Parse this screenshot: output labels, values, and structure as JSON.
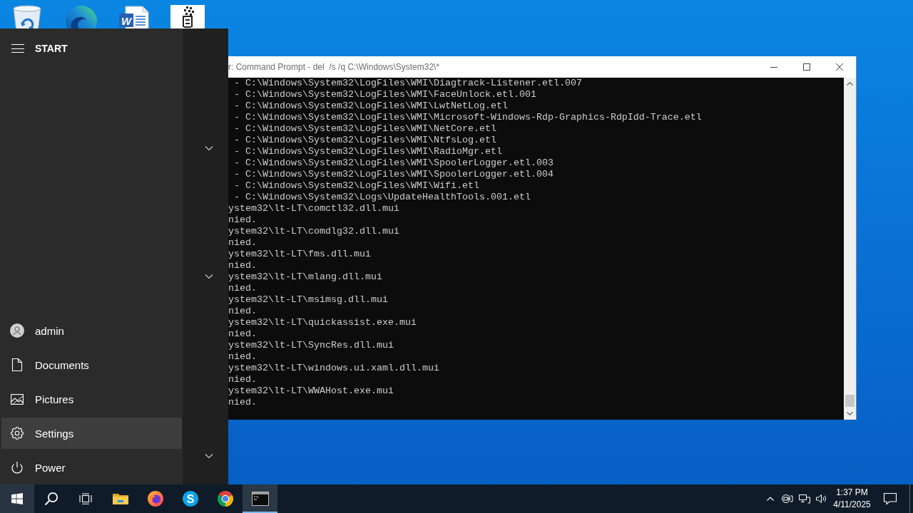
{
  "desktop_icons": [
    {
      "kind": "bin"
    },
    {
      "kind": "swirl"
    },
    {
      "kind": "document",
      "letter": "W"
    },
    {
      "kind": "pixel-art"
    }
  ],
  "console": {
    "title": "r: Command Prompt - del  /s /q C:\\Windows\\System32\\*",
    "lines": [
      " - C:\\Windows\\System32\\LogFiles\\WMI\\Diagtrack-Listener.etl.007",
      " - C:\\Windows\\System32\\LogFiles\\WMI\\FaceUnlock.etl.001",
      " - C:\\Windows\\System32\\LogFiles\\WMI\\LwtNetLog.etl",
      " - C:\\Windows\\System32\\LogFiles\\WMI\\Microsoft-Windows-Rdp-Graphics-RdpIdd-Trace.etl",
      " - C:\\Windows\\System32\\LogFiles\\WMI\\NetCore.etl",
      " - C:\\Windows\\System32\\LogFiles\\WMI\\NtfsLog.etl",
      " - C:\\Windows\\System32\\LogFiles\\WMI\\RadioMgr.etl",
      " - C:\\Windows\\System32\\LogFiles\\WMI\\SpoolerLogger.etl.003",
      " - C:\\Windows\\System32\\LogFiles\\WMI\\SpoolerLogger.etl.004",
      " - C:\\Windows\\System32\\LogFiles\\WMI\\Wifi.etl",
      " - C:\\Windows\\System32\\Logs\\UpdateHealthTools.001.etl",
      "ystem32\\lt-LT\\comctl32.dll.mui",
      "nied.",
      "ystem32\\lt-LT\\comdlg32.dll.mui",
      "nied.",
      "ystem32\\lt-LT\\fms.dll.mui",
      "nied.",
      "ystem32\\lt-LT\\mlang.dll.mui",
      "nied.",
      "ystem32\\lt-LT\\msimsg.dll.mui",
      "nied.",
      "ystem32\\lt-LT\\quickassist.exe.mui",
      "nied.",
      "ystem32\\lt-LT\\SyncRes.dll.mui",
      "nied.",
      "ystem32\\lt-LT\\windows.ui.xaml.dll.mui",
      "nied.",
      "ystem32\\lt-LT\\WWAHost.exe.mui",
      "nied."
    ]
  },
  "start_menu": {
    "title": "START",
    "items": [
      {
        "kind": "account",
        "label": "admin",
        "selected": false
      },
      {
        "kind": "documents",
        "label": "Documents",
        "selected": false
      },
      {
        "kind": "pictures",
        "label": "Pictures",
        "selected": false
      },
      {
        "kind": "settings",
        "label": "Settings",
        "selected": true
      },
      {
        "kind": "power",
        "label": "Power",
        "selected": false
      }
    ]
  },
  "taskbar": {
    "start_button": {
      "active": true
    },
    "items": [
      {
        "kind": "search",
        "active": false
      },
      {
        "kind": "task-view",
        "active": false
      },
      {
        "kind": "folder",
        "active": false
      },
      {
        "kind": "fox",
        "active": false
      },
      {
        "kind": "chat",
        "letter": "S",
        "active": false
      },
      {
        "kind": "ring",
        "active": false
      },
      {
        "kind": "terminal",
        "active": true
      }
    ],
    "clock": {
      "time": "1:37 PM",
      "date": "4/11/2025"
    }
  }
}
